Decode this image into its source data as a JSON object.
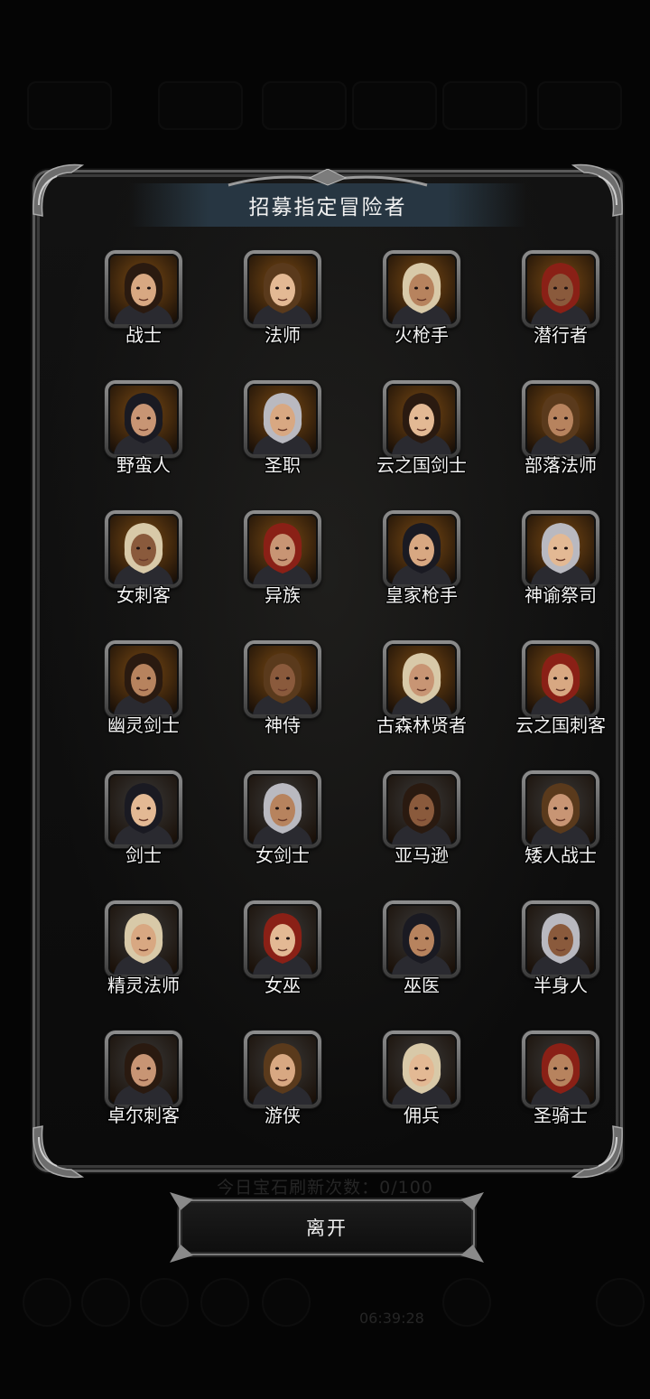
{
  "dialog": {
    "title": "招募指定冒险者",
    "leave_label": "离开"
  },
  "background": {
    "refresh_text": "今日宝石刷新次数：0/100",
    "timer_text": "06:39:28"
  },
  "classes": [
    {
      "name": "战士",
      "icon": "knight-helmet-portrait",
      "bg": "#7a4a14"
    },
    {
      "name": "法师",
      "icon": "hooded-mage-portrait",
      "bg": "#7a4a14"
    },
    {
      "name": "火枪手",
      "icon": "musketeer-portrait",
      "bg": "#7a4a14"
    },
    {
      "name": "潜行者",
      "icon": "masked-rogue-portrait",
      "bg": "#7a4a14"
    },
    {
      "name": "野蛮人",
      "icon": "barbarian-portrait",
      "bg": "#7a4a14"
    },
    {
      "name": "圣职",
      "icon": "nun-portrait",
      "bg": "#7a4a14"
    },
    {
      "name": "云之国剑士",
      "icon": "straw-hat-swordsman-portrait",
      "bg": "#7a4a14"
    },
    {
      "name": "部落法师",
      "icon": "tribal-mage-portrait",
      "bg": "#7a4a14"
    },
    {
      "name": "女刺客",
      "icon": "female-assassin-portrait",
      "bg": "#7a4a14"
    },
    {
      "name": "异族",
      "icon": "beast-demon-portrait",
      "bg": "#7a4a14"
    },
    {
      "name": "皇家枪手",
      "icon": "royal-gunner-portrait",
      "bg": "#7a4a14"
    },
    {
      "name": "神谕祭司",
      "icon": "oracle-priestess-portrait",
      "bg": "#7a4a14"
    },
    {
      "name": "幽灵剑士",
      "icon": "ghost-swordsman-portrait",
      "bg": "#7a4a14"
    },
    {
      "name": "神侍",
      "icon": "divine-servant-portrait",
      "bg": "#7a4a14"
    },
    {
      "name": "古森林贤者",
      "icon": "forest-sage-portrait",
      "bg": "#7a4a14"
    },
    {
      "name": "云之国刺客",
      "icon": "cloud-assassin-portrait",
      "bg": "#7a4a14"
    },
    {
      "name": "剑士",
      "icon": "swordsman-portrait",
      "bg": "#3a3a3a"
    },
    {
      "name": "女剑士",
      "icon": "female-swordsman-portrait",
      "bg": "#3a3a3a"
    },
    {
      "name": "亚马逊",
      "icon": "amazon-portrait",
      "bg": "#3a3a3a"
    },
    {
      "name": "矮人战士",
      "icon": "dwarf-warrior-portrait",
      "bg": "#3a3a3a"
    },
    {
      "name": "精灵法师",
      "icon": "elf-mage-portrait",
      "bg": "#3a3a3a"
    },
    {
      "name": "女巫",
      "icon": "witch-portrait",
      "bg": "#3a3a3a"
    },
    {
      "name": "巫医",
      "icon": "witch-doctor-portrait",
      "bg": "#3a3a3a"
    },
    {
      "name": "半身人",
      "icon": "halfling-portrait",
      "bg": "#3a3a3a"
    },
    {
      "name": "卓尔刺客",
      "icon": "drow-assassin-portrait",
      "bg": "#3a3a3a"
    },
    {
      "name": "游侠",
      "icon": "ranger-portrait",
      "bg": "#3a3a3a"
    },
    {
      "name": "佣兵",
      "icon": "mercenary-portrait",
      "bg": "#3a3a3a"
    },
    {
      "name": "圣骑士",
      "icon": "paladin-portrait",
      "bg": "#3a3a3a"
    }
  ]
}
